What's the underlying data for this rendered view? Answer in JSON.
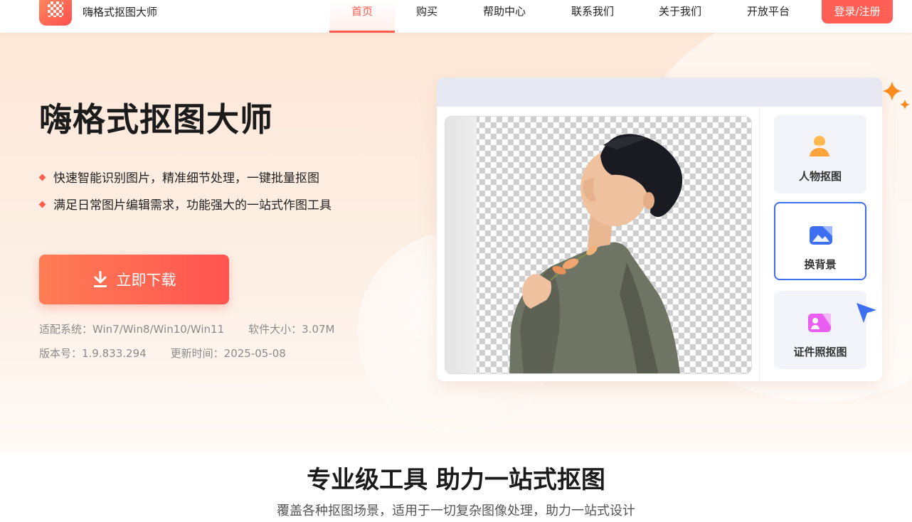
{
  "brand": {
    "name": "嗨格式抠图大师"
  },
  "nav": {
    "items": [
      {
        "label": "首页",
        "active": true
      },
      {
        "label": "购买"
      },
      {
        "label": "帮助中心"
      },
      {
        "label": "联系我们"
      },
      {
        "label": "关于我们"
      },
      {
        "label": "开放平台"
      }
    ],
    "login_label": "登录/注册"
  },
  "hero": {
    "title": "嗨格式抠图大师",
    "features": [
      "快速智能识别图片，精准细节处理，一键批量抠图",
      "满足日常图片编辑需求，功能强大的一站式作图工具"
    ],
    "download_label": "立即下载",
    "system_label": "适配系统：Win7/Win8/Win10/Win11",
    "size_label": "软件大小：3.07M",
    "version_label": "版本号：1.9.833.294",
    "update_label": "更新时间：2025-05-08"
  },
  "app_preview": {
    "tools": [
      {
        "label": "人物抠图",
        "icon": "person-cutout-icon"
      },
      {
        "label": "换背景",
        "icon": "change-background-icon",
        "selected": true
      },
      {
        "label": "证件照抠图",
        "icon": "id-photo-icon"
      }
    ]
  },
  "section": {
    "title": "专业级工具 助力一站式抠图",
    "subtitle": "覆盖各种抠图场景，适用于一切复杂图像处理，助力一站式设计"
  },
  "colors": {
    "accent": "#ff5a4e",
    "selected_border": "#3e6ff1",
    "hero_bg": "#fde7d8"
  }
}
